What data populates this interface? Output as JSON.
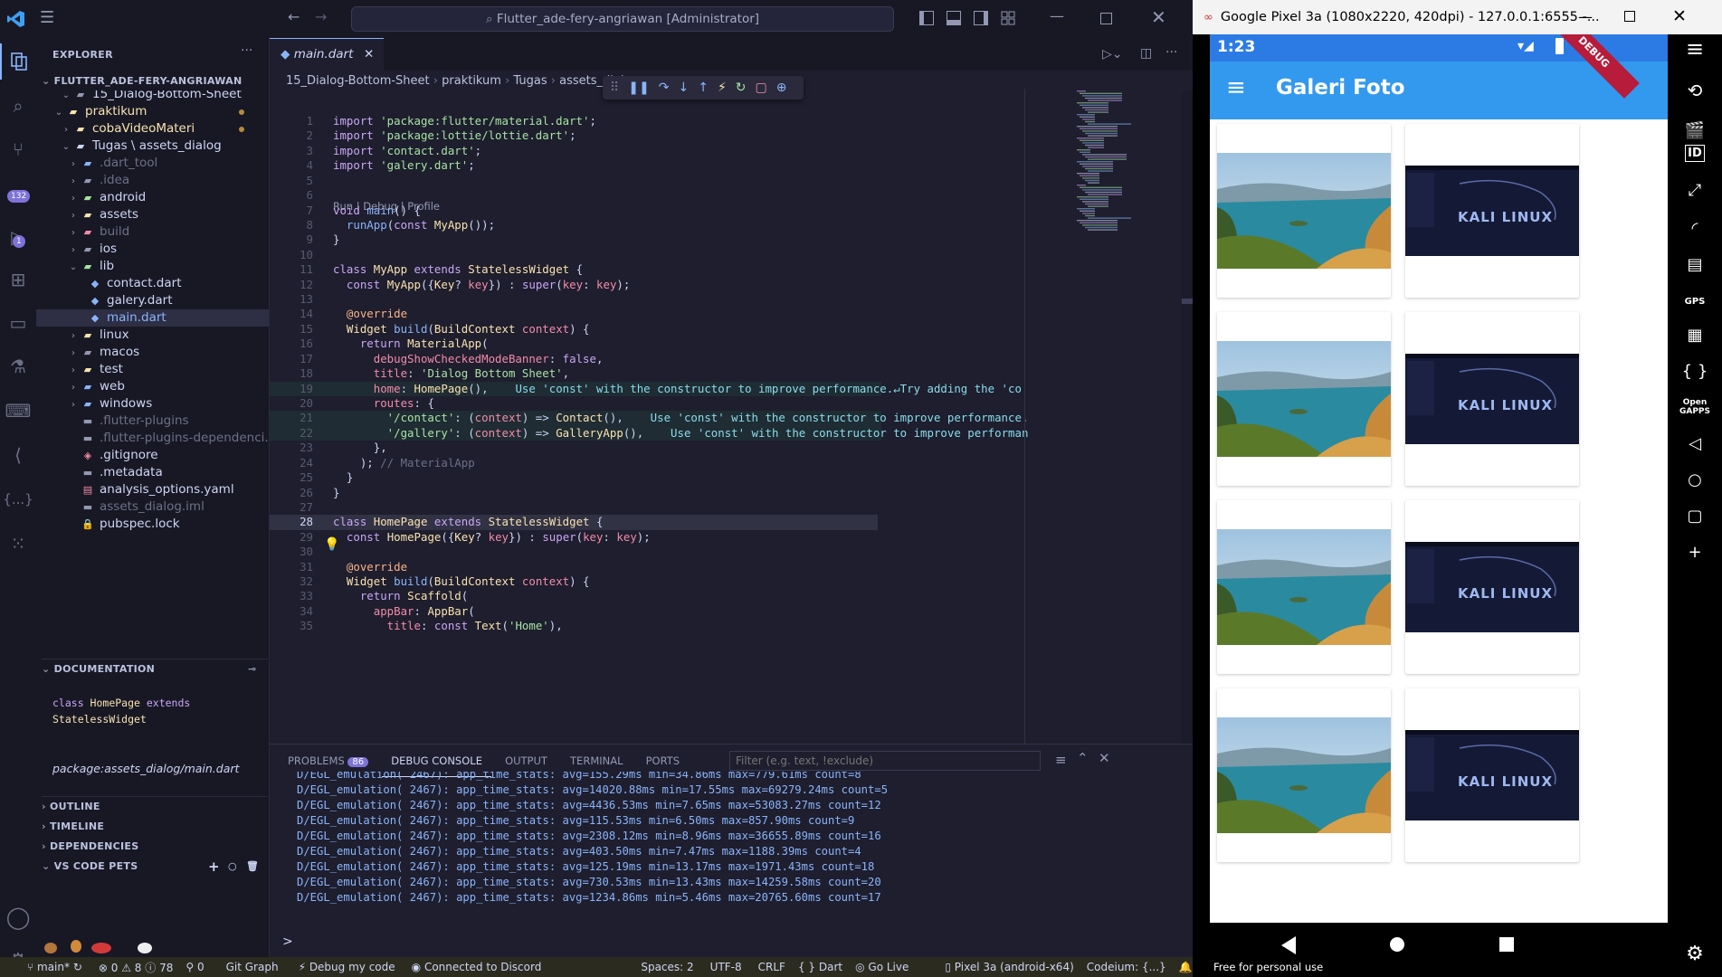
{
  "titlebar": {
    "search_text": "Flutter_ade-fery-angriawan [Administrator]"
  },
  "activity": {
    "source_control_badge": "132",
    "run_badge": "1",
    "settings_badge": "1"
  },
  "sidebar": {
    "header": "EXPLORER",
    "root": "FLUTTER_ADE-FERY-ANGRIAWAN",
    "tree": [
      {
        "label": "15_Dialog-Bottom-Sheet",
        "level": 2,
        "kind": "folder-partial",
        "dim": false
      },
      {
        "label": "praktikum",
        "level": 1,
        "kind": "folder-open",
        "dim": false,
        "color": "#f9e2af",
        "dot": true
      },
      {
        "label": "cobaVideoMateri",
        "level": 2,
        "kind": "folder",
        "dim": false,
        "color": "#f9e2af",
        "dot": true
      },
      {
        "label": "Tugas \\ assets_dialog",
        "level": 2,
        "kind": "folder-open",
        "dim": false
      },
      {
        "label": ".dart_tool",
        "level": 3,
        "kind": "folder",
        "dim": true
      },
      {
        "label": ".idea",
        "level": 3,
        "kind": "folder",
        "dim": true
      },
      {
        "label": "android",
        "level": 3,
        "kind": "folder",
        "dim": false
      },
      {
        "label": "assets",
        "level": 3,
        "kind": "folder",
        "dim": false
      },
      {
        "label": "build",
        "level": 3,
        "kind": "folder",
        "dim": true
      },
      {
        "label": "ios",
        "level": 3,
        "kind": "folder",
        "dim": false
      },
      {
        "label": "lib",
        "level": 3,
        "kind": "folder-open",
        "dim": false
      },
      {
        "label": "contact.dart",
        "level": 4,
        "kind": "dart",
        "dim": false
      },
      {
        "label": "galery.dart",
        "level": 4,
        "kind": "dart",
        "dim": false
      },
      {
        "label": "main.dart",
        "level": 4,
        "kind": "dart",
        "dim": false,
        "selected": true
      },
      {
        "label": "linux",
        "level": 3,
        "kind": "folder",
        "dim": false
      },
      {
        "label": "macos",
        "level": 3,
        "kind": "folder",
        "dim": false
      },
      {
        "label": "test",
        "level": 3,
        "kind": "folder",
        "dim": false
      },
      {
        "label": "web",
        "level": 3,
        "kind": "folder",
        "dim": false
      },
      {
        "label": "windows",
        "level": 3,
        "kind": "folder",
        "dim": false
      },
      {
        "label": ".flutter-plugins",
        "level": 3,
        "kind": "file",
        "dim": true
      },
      {
        "label": ".flutter-plugins-dependenci...",
        "level": 3,
        "kind": "file",
        "dim": true
      },
      {
        "label": ".gitignore",
        "level": 3,
        "kind": "git",
        "dim": false
      },
      {
        "label": ".metadata",
        "level": 3,
        "kind": "file",
        "dim": false
      },
      {
        "label": "analysis_options.yaml",
        "level": 3,
        "kind": "yaml",
        "dim": false
      },
      {
        "label": "assets_dialog.iml",
        "level": 3,
        "kind": "file",
        "dim": true
      },
      {
        "label": "pubspec.lock",
        "level": 3,
        "kind": "lock",
        "dim": false
      }
    ],
    "documentation_header": "DOCUMENTATION",
    "doc_line1": "class HomePage extends",
    "doc_line2": "StatelessWidget",
    "doc_path": "package:assets_dialog/main.dart",
    "sections": [
      "OUTLINE",
      "TIMELINE",
      "DEPENDENCIES",
      "VS CODE PETS"
    ]
  },
  "editor": {
    "tab_label": "main.dart",
    "breadcrumb": [
      "15_Dialog-Bottom-Sheet",
      "praktikum",
      "Tugas",
      "assets_dial"
    ],
    "codelens": "Run | Debug | Profile",
    "current_line": 28,
    "lines": [
      {
        "n": "1",
        "tokens": [
          [
            "kw",
            "import "
          ],
          [
            "st",
            "'package:flutter/material.dart'"
          ],
          [
            "pl",
            ";"
          ]
        ]
      },
      {
        "n": "2",
        "tokens": [
          [
            "kw",
            "import "
          ],
          [
            "st",
            "'package:lottie/lottie.dart'"
          ],
          [
            "pl",
            ";"
          ]
        ]
      },
      {
        "n": "3",
        "tokens": [
          [
            "kw",
            "import "
          ],
          [
            "st",
            "'contact.dart'"
          ],
          [
            "pl",
            ";"
          ]
        ]
      },
      {
        "n": "4",
        "tokens": [
          [
            "kw",
            "import "
          ],
          [
            "st",
            "'galery.dart'"
          ],
          [
            "pl",
            ";"
          ]
        ]
      },
      {
        "n": "5",
        "tokens": []
      },
      {
        "n": "6",
        "tokens": []
      },
      {
        "n": "7",
        "tokens": [
          [
            "kw",
            "void "
          ],
          [
            "fn",
            "main"
          ],
          [
            "pl",
            "() {"
          ]
        ]
      },
      {
        "n": "8",
        "tokens": [
          [
            "fn",
            "  runApp"
          ],
          [
            "pl",
            "("
          ],
          [
            "kw",
            "const "
          ],
          [
            "cl",
            "MyApp"
          ],
          [
            "pl",
            "());"
          ]
        ]
      },
      {
        "n": "9",
        "tokens": [
          [
            "pl",
            "}"
          ]
        ]
      },
      {
        "n": "10",
        "tokens": []
      },
      {
        "n": "11",
        "tokens": [
          [
            "kw",
            "class "
          ],
          [
            "cl",
            "MyApp "
          ],
          [
            "kw",
            "extends "
          ],
          [
            "cl",
            "StatelessWidget "
          ],
          [
            "pl",
            "{"
          ]
        ]
      },
      {
        "n": "12",
        "tokens": [
          [
            "kw",
            "  const "
          ],
          [
            "cl",
            "MyApp"
          ],
          [
            "pl",
            "({"
          ],
          [
            "cl",
            "Key"
          ],
          [
            "pl",
            "? "
          ],
          [
            "pr",
            "key"
          ],
          [
            "pl",
            "}) : "
          ],
          [
            "kw",
            "super"
          ],
          [
            "pl",
            "("
          ],
          [
            "pr",
            "key"
          ],
          [
            "pl",
            ": "
          ],
          [
            "pr",
            "key"
          ],
          [
            "pl",
            ");"
          ]
        ]
      },
      {
        "n": "13",
        "tokens": []
      },
      {
        "n": "14",
        "tokens": [
          [
            "an",
            "  @override"
          ]
        ]
      },
      {
        "n": "15",
        "tokens": [
          [
            "cl",
            "  Widget "
          ],
          [
            "fn",
            "build"
          ],
          [
            "pl",
            "("
          ],
          [
            "cl",
            "BuildContext "
          ],
          [
            "pr",
            "context"
          ],
          [
            "pl",
            ") {"
          ]
        ]
      },
      {
        "n": "16",
        "tokens": [
          [
            "kw",
            "    return "
          ],
          [
            "cl",
            "MaterialApp"
          ],
          [
            "pl",
            "("
          ]
        ]
      },
      {
        "n": "17",
        "tokens": [
          [
            "pr",
            "      debugShowCheckedModeBanner"
          ],
          [
            "pl",
            ": "
          ],
          [
            "kw",
            "false"
          ],
          [
            "pl",
            ","
          ]
        ]
      },
      {
        "n": "18",
        "tokens": [
          [
            "pr",
            "      title"
          ],
          [
            "pl",
            ": "
          ],
          [
            "st",
            "'Dialog Bottom Sheet'"
          ],
          [
            "pl",
            ","
          ]
        ]
      },
      {
        "n": "19",
        "tokens": [
          [
            "pr",
            "      home"
          ],
          [
            "pl",
            ": "
          ],
          [
            "cl",
            "HomePage"
          ],
          [
            "pl",
            "(),"
          ],
          [
            "hint",
            "    Use 'const' with the constructor to improve performance.↵Try adding the 'co"
          ]
        ]
      },
      {
        "n": "20",
        "tokens": [
          [
            "pr",
            "      routes"
          ],
          [
            "pl",
            ": {"
          ]
        ]
      },
      {
        "n": "21",
        "tokens": [
          [
            "st",
            "        '/contact'"
          ],
          [
            "pl",
            ": ("
          ],
          [
            "pr",
            "context"
          ],
          [
            "pl",
            ") => "
          ],
          [
            "cl",
            "Contact"
          ],
          [
            "pl",
            "(),"
          ],
          [
            "hint",
            "    Use 'const' with the constructor to improve performance."
          ]
        ]
      },
      {
        "n": "22",
        "tokens": [
          [
            "st",
            "        '/gallery'"
          ],
          [
            "pl",
            ": ("
          ],
          [
            "pr",
            "context"
          ],
          [
            "pl",
            ") => "
          ],
          [
            "cl",
            "GalleryApp"
          ],
          [
            "pl",
            "(),"
          ],
          [
            "hint",
            "    Use 'const' with the constructor to improve performan"
          ]
        ]
      },
      {
        "n": "23",
        "tokens": [
          [
            "pl",
            "      },"
          ]
        ]
      },
      {
        "n": "24",
        "tokens": [
          [
            "pl",
            "    ); "
          ],
          [
            "cm",
            "// MaterialApp"
          ]
        ]
      },
      {
        "n": "25",
        "tokens": [
          [
            "pl",
            "  }"
          ]
        ]
      },
      {
        "n": "26",
        "tokens": [
          [
            "pl",
            "}"
          ]
        ]
      },
      {
        "n": "27",
        "tokens": []
      },
      {
        "n": "28",
        "tokens": [
          [
            "kw",
            "class "
          ],
          [
            "cl",
            "HomePage "
          ],
          [
            "kw",
            "extends "
          ],
          [
            "cl",
            "StatelessWidget "
          ],
          [
            "pl",
            "{"
          ]
        ]
      },
      {
        "n": "29",
        "tokens": [
          [
            "kw",
            "  const "
          ],
          [
            "cl",
            "HomePage"
          ],
          [
            "pl",
            "({"
          ],
          [
            "cl",
            "Key"
          ],
          [
            "pl",
            "? "
          ],
          [
            "pr",
            "key"
          ],
          [
            "pl",
            "}) : "
          ],
          [
            "kw",
            "super"
          ],
          [
            "pl",
            "("
          ],
          [
            "pr",
            "key"
          ],
          [
            "pl",
            ": "
          ],
          [
            "pr",
            "key"
          ],
          [
            "pl",
            ");"
          ]
        ]
      },
      {
        "n": "30",
        "tokens": []
      },
      {
        "n": "31",
        "tokens": [
          [
            "an",
            "  @override"
          ]
        ]
      },
      {
        "n": "32",
        "tokens": [
          [
            "cl",
            "  Widget "
          ],
          [
            "fn",
            "build"
          ],
          [
            "pl",
            "("
          ],
          [
            "cl",
            "BuildContext "
          ],
          [
            "pr",
            "context"
          ],
          [
            "pl",
            ") {"
          ]
        ]
      },
      {
        "n": "33",
        "tokens": [
          [
            "kw",
            "    return "
          ],
          [
            "cl",
            "Scaffold"
          ],
          [
            "pl",
            "("
          ]
        ]
      },
      {
        "n": "34",
        "tokens": [
          [
            "pr",
            "      appBar"
          ],
          [
            "pl",
            ": "
          ],
          [
            "cl",
            "AppBar"
          ],
          [
            "pl",
            "("
          ]
        ]
      },
      {
        "n": "35",
        "tokens": [
          [
            "pr",
            "        title"
          ],
          [
            "pl",
            ": "
          ],
          [
            "kw",
            "const "
          ],
          [
            "cl",
            "Text"
          ],
          [
            "pl",
            "("
          ],
          [
            "st",
            "'Home'"
          ],
          [
            "pl",
            "),"
          ]
        ]
      }
    ]
  },
  "panel": {
    "tabs": [
      "PROBLEMS",
      "DEBUG CONSOLE",
      "OUTPUT",
      "TERMINAL",
      "PORTS"
    ],
    "problems_count": "86",
    "active_tab": "DEBUG CONSOLE",
    "filter_placeholder": "Filter (e.g. text, !exclude)",
    "logs": [
      "D/EGL_emulation( 2467): app_time_stats: avg=155.29ms min=34.86ms max=779.61ms count=8",
      "D/EGL_emulation( 2467): app_time_stats: avg=14020.88ms min=17.55ms max=69279.24ms count=5",
      "D/EGL_emulation( 2467): app_time_stats: avg=4436.53ms min=7.65ms max=53083.27ms count=12",
      "D/EGL_emulation( 2467): app_time_stats: avg=115.53ms min=6.50ms max=857.90ms count=9",
      "D/EGL_emulation( 2467): app_time_stats: avg=2308.12ms min=8.96ms max=36655.89ms count=16",
      "D/EGL_emulation( 2467): app_time_stats: avg=403.50ms min=7.47ms max=1188.39ms count=4",
      "D/EGL_emulation( 2467): app_time_stats: avg=125.19ms min=13.17ms max=1971.43ms count=18",
      "D/EGL_emulation( 2467): app_time_stats: avg=730.53ms min=13.43ms max=14259.58ms count=20",
      "D/EGL_emulation( 2467): app_time_stats: avg=1234.86ms min=5.46ms max=20765.60ms count=17"
    ],
    "prompt": ">"
  },
  "statusbar": {
    "branch": "main*",
    "errors": "0",
    "warnings": "8",
    "infos": "78",
    "ports": "0",
    "git_graph": "Git Graph",
    "debug": "Debug my code",
    "discord": "Connected to Discord",
    "spaces": "Spaces: 2",
    "encoding": "UTF-8",
    "eol": "CRLF",
    "language": "Dart",
    "golive": "Go Live",
    "device": "Pixel 3a (android-x64)",
    "codeium": "Codeium: {...}"
  },
  "emulator": {
    "window_title": "Google Pixel 3a (1080x2220, 420dpi) - 127.0.0.1:6555 -...",
    "clock": "1:23",
    "app_title": "Galeri Foto",
    "debug_ribbon": "DEBUG",
    "watermark": "Free for personal use",
    "kali_text": "KALI LINUX",
    "tools": [
      "power",
      "rotate",
      "camera",
      "ID",
      "fullscreen",
      "rss",
      "phone-sd",
      "GPS",
      "film",
      "code",
      "Open GAPPS",
      "back",
      "home",
      "overview",
      "add",
      "settings"
    ]
  }
}
